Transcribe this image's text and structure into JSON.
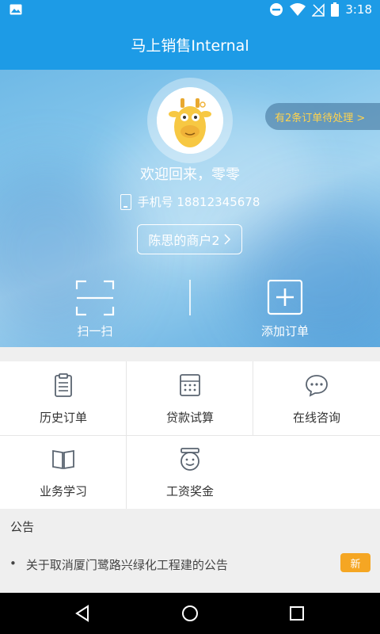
{
  "status_bar": {
    "time": "3:18"
  },
  "app_bar": {
    "title": "马上销售Internal"
  },
  "hero": {
    "pending_orders": "有2条订单待处理 >",
    "welcome": "欢迎回来，零零",
    "phone": "手机号 18812345678",
    "merchant": "陈思的商户2"
  },
  "actions": [
    {
      "label": "扫一扫",
      "icon": "scan-icon"
    },
    {
      "label": "添加订单",
      "icon": "add-order-icon"
    }
  ],
  "grid": [
    {
      "label": "历史订单",
      "icon": "clipboard-icon"
    },
    {
      "label": "贷款试算",
      "icon": "calculator-icon"
    },
    {
      "label": "在线咨询",
      "icon": "chat-icon"
    },
    {
      "label": "业务学习",
      "icon": "book-icon"
    },
    {
      "label": "工资奖金",
      "icon": "smile-badge-icon"
    }
  ],
  "notice": {
    "title": "公告",
    "items": [
      {
        "text": "关于取消厦门鹭路兴绿化工程建的公告",
        "badge": "新"
      }
    ]
  },
  "colors": {
    "primary": "#1d9be6",
    "badge": "#f5a623",
    "pending_text": "#ffd34d",
    "icon": "#5a6470"
  }
}
